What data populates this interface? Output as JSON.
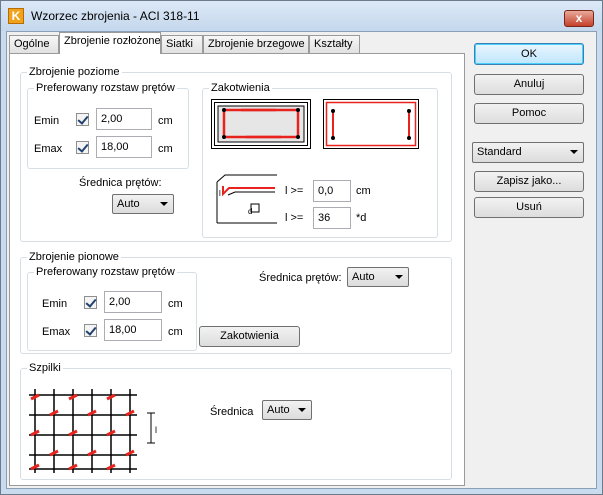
{
  "window": {
    "title": "Wzorzec zbrojenia - ACI 318-11",
    "close_glyph": "x"
  },
  "tabs": [
    {
      "label": "Ogólne"
    },
    {
      "label": "Zbrojenie rozłożone",
      "active": true
    },
    {
      "label": "Siatki"
    },
    {
      "label": "Zbrojenie brzegowe"
    },
    {
      "label": "Kształty"
    }
  ],
  "horizontal": {
    "title": "Zbrojenie poziome",
    "spacing_group": "Preferowany rozstaw prętów",
    "emin_label": "Emin",
    "emin_value": "2,00",
    "emin_unit": "cm",
    "emax_label": "Emax",
    "emax_value": "18,00",
    "emax_unit": "cm",
    "diameter_label": "Średnica prętów:",
    "diameter_value": "Auto",
    "anchorage_title": "Zakotwienia",
    "l_label_1": "l >=",
    "l_value_1": "0,0",
    "l_unit_1": "cm",
    "l_label_2": "l >=",
    "l_value_2": "36",
    "l_unit_2": "*d"
  },
  "vertical": {
    "title": "Zbrojenie pionowe",
    "spacing_group": "Preferowany rozstaw prętów",
    "emin_label": "Emin",
    "emin_value": "2,00",
    "emin_unit": "cm",
    "emax_label": "Emax",
    "emax_value": "18,00",
    "emax_unit": "cm",
    "diameter_label": "Średnica prętów:",
    "diameter_value": "Auto",
    "anchorage_button": "Zakotwienia"
  },
  "pins": {
    "title": "Szpilki",
    "diameter_label": "Średnica",
    "diameter_value": "Auto"
  },
  "side": {
    "ok": "OK",
    "cancel": "Anuluj",
    "help": "Pomoc",
    "preset_value": "Standard",
    "save_as": "Zapisz jako...",
    "delete": "Usuń"
  },
  "colors": {
    "accent_red": "#e8231e",
    "title_bar": "#c9dbee",
    "default_button": "#bee6fd"
  }
}
